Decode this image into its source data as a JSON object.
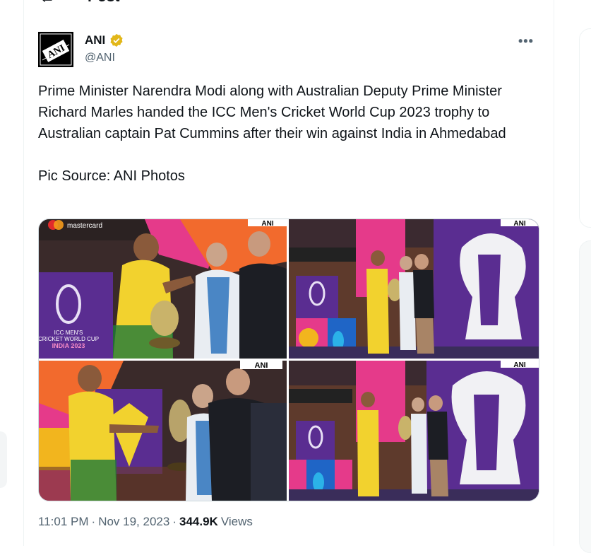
{
  "header": {
    "title": "Post",
    "back_icon": "arrow-left-icon"
  },
  "author": {
    "display_name": "ANI",
    "handle": "@ANI",
    "avatar_text": "ANI",
    "verified_color": "#e2b719"
  },
  "tweet": {
    "text": "Prime Minister Narendra Modi along with Australian Deputy Prime Minister Richard Marles handed the ICC Men's Cricket World Cup 2023 trophy to Australian captain Pat Cummins after their win against India in Ahmedabad\n\nPic Source: ANI Photos"
  },
  "media": {
    "watermark": "ANI",
    "banner_text": "mastercard",
    "logo_line1": "ICC MEN'S",
    "logo_line2": "CRICKET WORLD CUP",
    "logo_line3": "INDIA 2023"
  },
  "meta": {
    "time": "11:01 PM",
    "separator": "·",
    "date": "Nov 19, 2023",
    "views_count": "344.9K",
    "views_label": "Views"
  },
  "colors": {
    "text": "#0f1419",
    "secondary": "#536471",
    "border": "#cfd9de",
    "jersey_yellow": "#f2d22e",
    "jersey_green": "#1f7a3a",
    "stage_purple": "#5a2d91"
  }
}
